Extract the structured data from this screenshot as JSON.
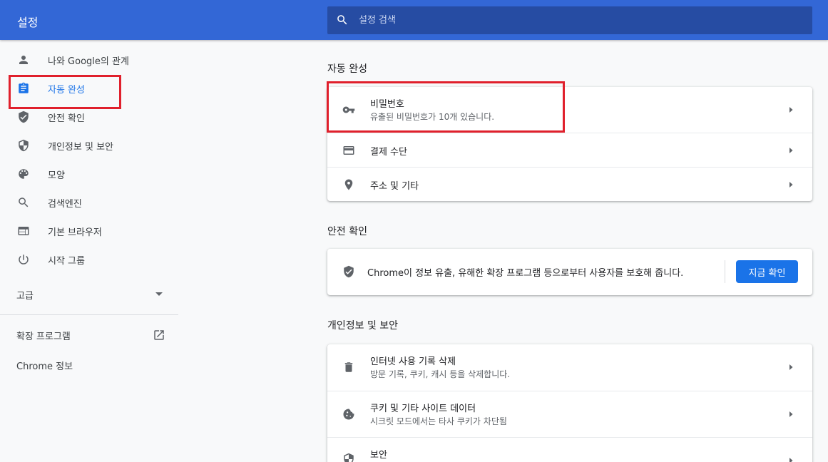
{
  "header": {
    "title": "설정"
  },
  "search": {
    "placeholder": "설정 검색"
  },
  "sidebar": {
    "items": [
      {
        "label": "나와 Google의 관계",
        "icon": "person-icon"
      },
      {
        "label": "자동 완성",
        "icon": "clipboard-icon",
        "active": true
      },
      {
        "label": "안전 확인",
        "icon": "shield-check-icon"
      },
      {
        "label": "개인정보 및 보안",
        "icon": "shield-half-icon"
      },
      {
        "label": "모양",
        "icon": "palette-icon"
      },
      {
        "label": "검색엔진",
        "icon": "search-icon"
      },
      {
        "label": "기본 브라우저",
        "icon": "browser-icon"
      },
      {
        "label": "시작 그룹",
        "icon": "power-icon"
      }
    ],
    "advanced": "고급",
    "extensions": "확장 프로그램",
    "about": "Chrome 정보"
  },
  "autofill": {
    "title": "자동 완성",
    "passwords": {
      "title": "비밀번호",
      "sub": "유출된 비밀번호가 10개 있습니다."
    },
    "payment": {
      "title": "결제 수단"
    },
    "addresses": {
      "title": "주소 및 기타"
    }
  },
  "safety": {
    "title": "안전 확인",
    "text": "Chrome이 정보 유출, 유해한 확장 프로그램 등으로부터 사용자를 보호해 줍니다.",
    "button": "지금 확인"
  },
  "privacy": {
    "title": "개인정보 및 보안",
    "clear": {
      "title": "인터넷 사용 기록 삭제",
      "sub": "방문 기록, 쿠키, 캐시 등을 삭제합니다."
    },
    "cookies": {
      "title": "쿠키 및 기타 사이트 데이터",
      "sub": "시크릿 모드에서는 타사 쿠키가 차단됨"
    },
    "security": {
      "title": "보안"
    }
  },
  "colors": {
    "header": "#3367d6",
    "accent": "#1a73e8",
    "highlight": "#e0202c"
  }
}
